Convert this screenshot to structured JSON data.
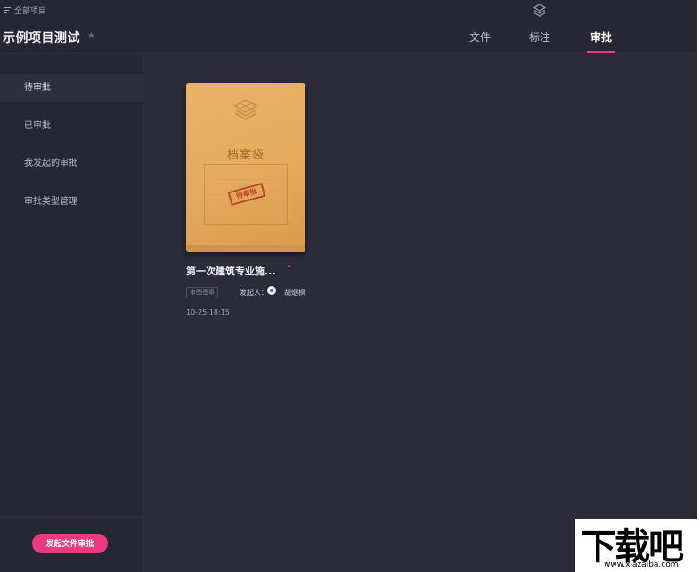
{
  "header": {
    "all_projects": "全部项目",
    "project_title": "示例项目测试",
    "tabs": [
      {
        "label": "文件"
      },
      {
        "label": "标注"
      },
      {
        "label": "审批"
      }
    ],
    "active_tab": "审批"
  },
  "sidebar": {
    "items": [
      {
        "label": "待审批"
      },
      {
        "label": "已审批"
      },
      {
        "label": "我发起的审批"
      },
      {
        "label": "审批类型管理"
      }
    ],
    "active_item": "待审批",
    "start_button": "发起文件审批"
  },
  "approval_card": {
    "folder_label": "档案袋",
    "stamp_text": "待审批",
    "title": "第一次建筑专业施...",
    "type_tag": "审图签章",
    "initiator_label": "发起人：",
    "initiator_name": "胡烟枫",
    "time": "10-25 18:15"
  },
  "watermark": {
    "text": "下载吧",
    "url": "www.xiazaiba.com"
  },
  "colors": {
    "background": "#2b2b3a",
    "accent": "#ea3a80",
    "card": "#e3aa5c"
  }
}
